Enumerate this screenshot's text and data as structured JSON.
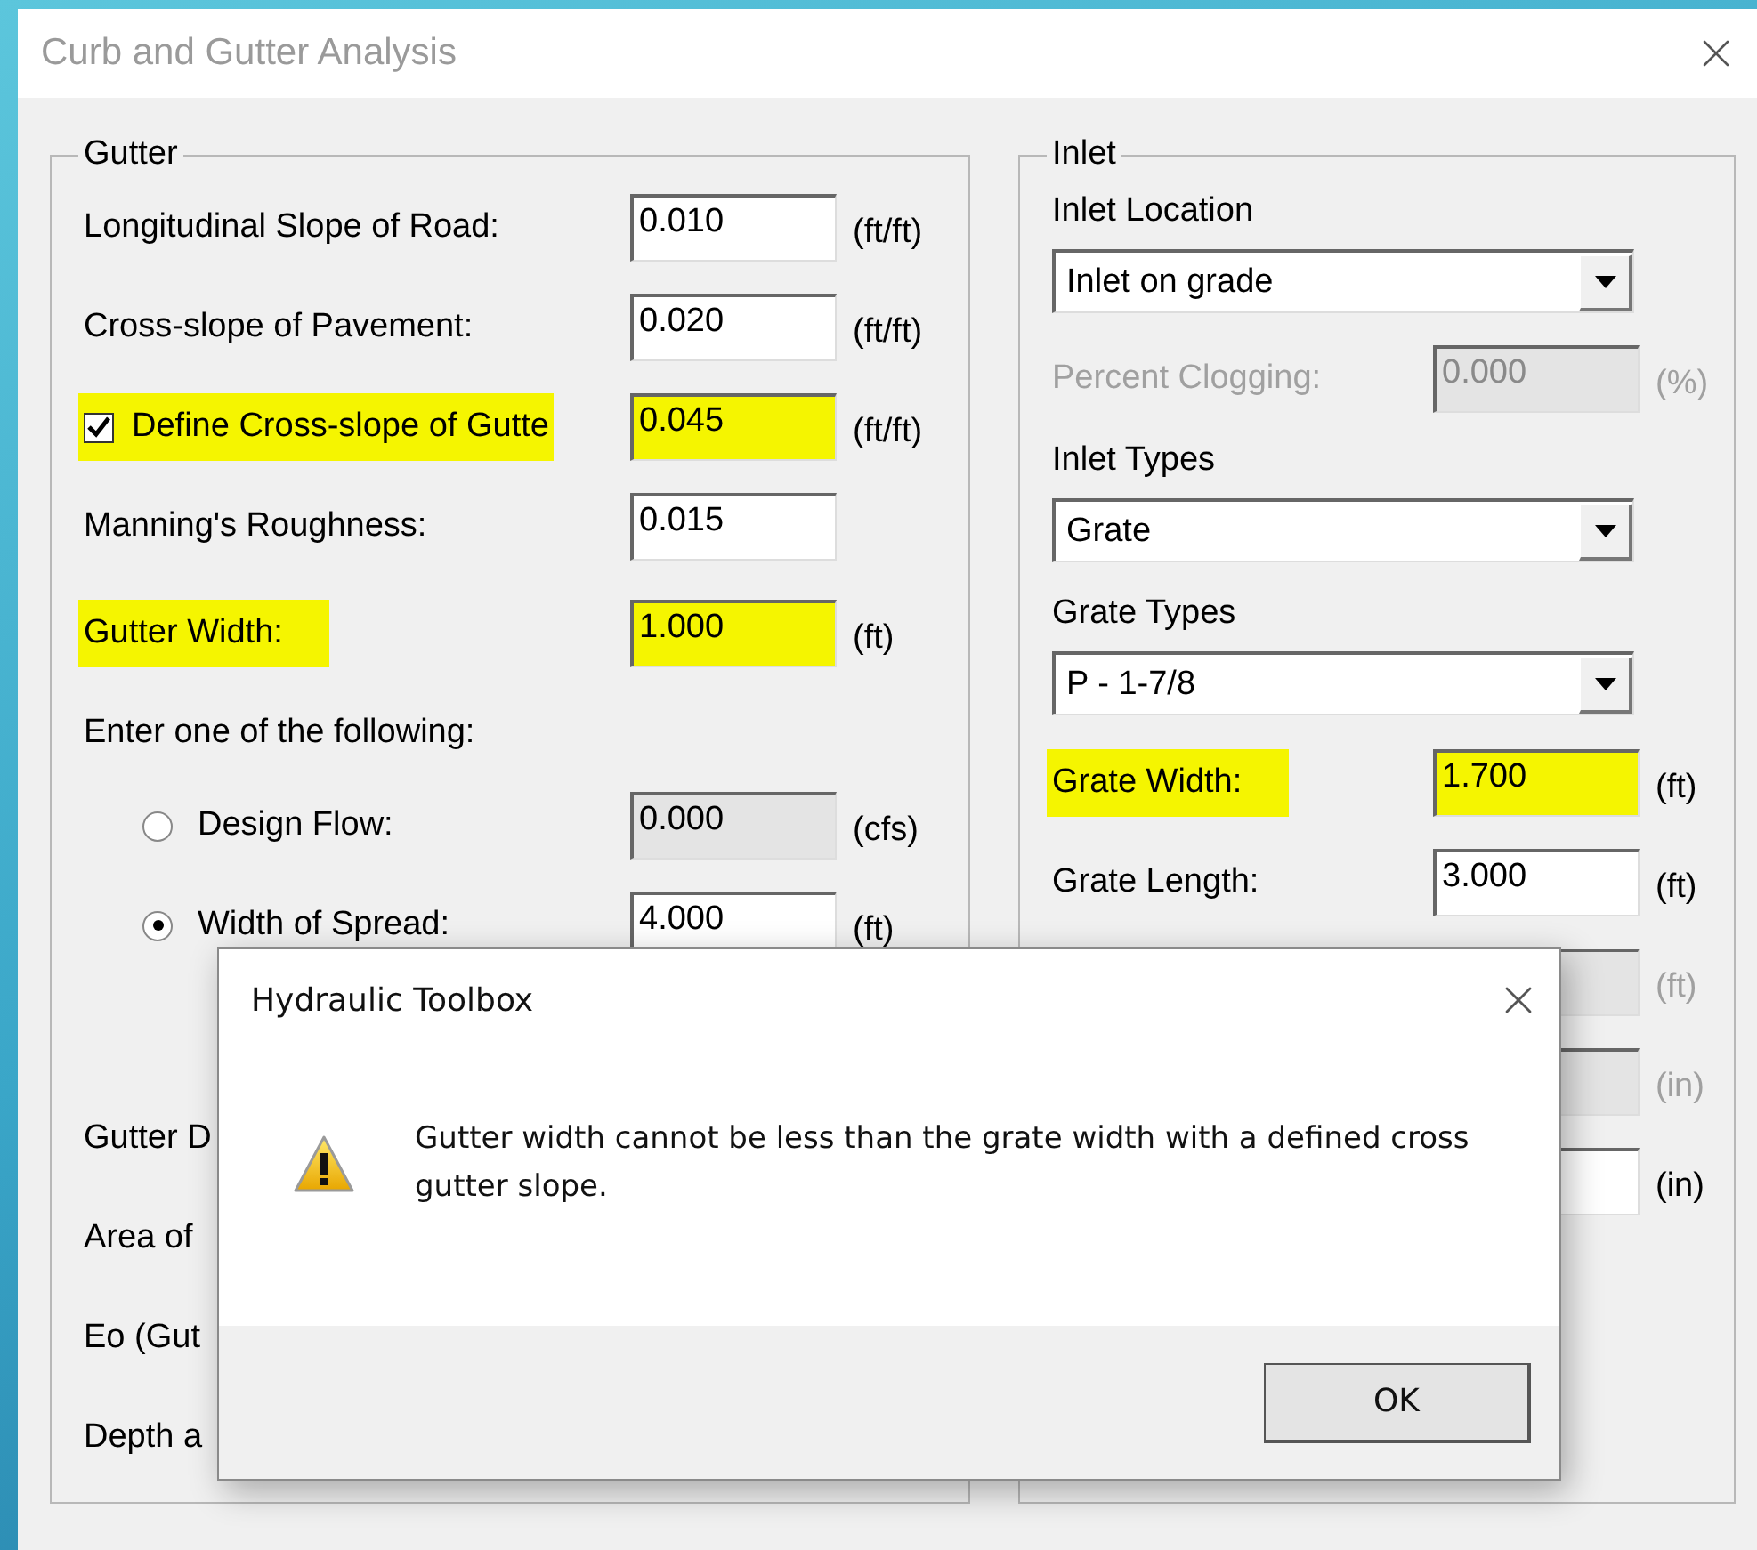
{
  "window": {
    "title": "Curb and Gutter Analysis"
  },
  "gutter": {
    "title": "Gutter",
    "fields": [
      {
        "kind": "input",
        "label": "Longitudinal Slope of Road:",
        "value": "0.010",
        "unit": "(ft/ft)",
        "highlighted": false
      },
      {
        "kind": "input",
        "label": "Cross-slope of Pavement:",
        "value": "0.020",
        "unit": "(ft/ft)",
        "highlighted": false
      },
      {
        "kind": "checkbox",
        "label": "Define Cross-slope of Gutte",
        "checked": true,
        "value": "0.045",
        "unit": "(ft/ft)",
        "highlighted": true
      },
      {
        "kind": "input",
        "label": "Manning's Roughness:",
        "value": "0.015",
        "highlighted": false
      },
      {
        "kind": "input",
        "label": "Gutter Width:",
        "value": "1.000",
        "unit": "(ft)",
        "highlighted": true
      }
    ],
    "prompt": "Enter one of the following:",
    "options": [
      {
        "label": "Design Flow:",
        "selected": false,
        "value": "0.000",
        "unit": "(cfs)",
        "input_disabled": true
      },
      {
        "label": "Width of Spread:",
        "selected": true,
        "value": "4.000",
        "unit": "(ft)",
        "input_disabled": false
      }
    ],
    "results": [
      {
        "label": "Gutter D"
      },
      {
        "label": "Area of"
      },
      {
        "label": "Eo (Gut"
      },
      {
        "label": "Depth a"
      }
    ]
  },
  "inlet": {
    "title": "Inlet",
    "items": [
      {
        "kind": "dropdown",
        "label": "Inlet Location",
        "value": "Inlet on grade"
      },
      {
        "kind": "input",
        "label": "Percent Clogging:",
        "value": "0.000",
        "unit": "(%)",
        "disabled": true,
        "highlighted": false
      },
      {
        "kind": "dropdown",
        "label": "Inlet Types",
        "value": "Grate"
      },
      {
        "kind": "dropdown",
        "label": "Grate Types",
        "value": "P - 1-7/8"
      },
      {
        "kind": "input",
        "label": "Grate Width:",
        "value": "1.700",
        "unit": "(ft)",
        "disabled": false,
        "highlighted": true
      },
      {
        "kind": "input",
        "label": "Grate Length:",
        "value": "3.000",
        "unit": "(ft)",
        "disabled": false,
        "highlighted": false
      },
      {
        "kind": "input",
        "unit": "(ft)",
        "disabled": true,
        "highlighted": false
      },
      {
        "kind": "input",
        "unit": "(in)",
        "disabled": true,
        "highlighted": false
      },
      {
        "kind": "input",
        "unit": "(in)",
        "disabled": false,
        "highlighted": false
      }
    ]
  },
  "message_box": {
    "title": "Hydraulic Toolbox",
    "message": "Gutter width cannot be less than the grate width with a defined cross gutter slope.",
    "button": "OK"
  }
}
